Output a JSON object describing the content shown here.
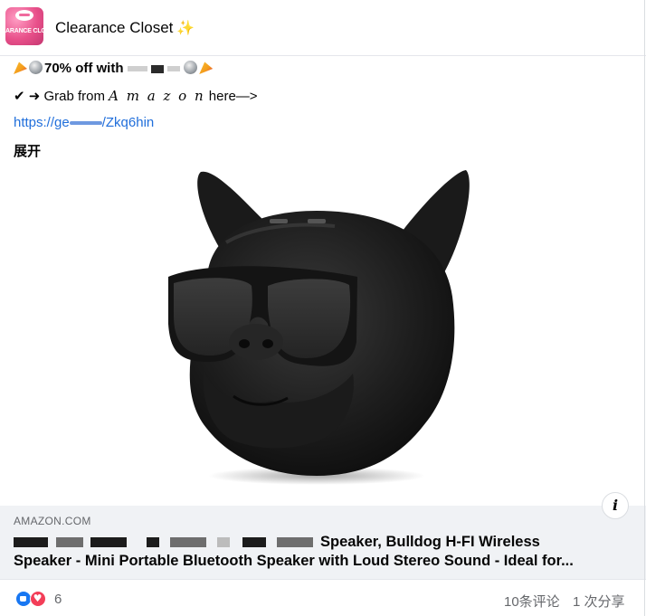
{
  "header": {
    "page_name": "Clearance Closet",
    "sparkle": "✨",
    "avatar_text": "ARANCE CLO"
  },
  "post": {
    "line1_text": "70% off with",
    "line2_prefix": "✔ ➜ Grab from",
    "line2_store": "𝐴 𝑚 𝑎 𝑧 𝑜 𝑛",
    "line2_suffix": "here—>",
    "link_start": "https://ge",
    "link_end": "/Zkq6hin",
    "expand": "展开"
  },
  "link_preview": {
    "domain": "AMAZON.COM",
    "title_line1_visible": "Speaker, Bulldog H-FI Wireless",
    "title_line2": "Speaker - Mini Portable Bluetooth Speaker with Loud Stereo Sound - Ideal for...",
    "info_icon": "i"
  },
  "footer": {
    "reaction_count": "6",
    "comments": "10条评论",
    "shares": "1 次分享"
  },
  "colors": {
    "link": "#216fdb",
    "like": "#1877f2",
    "love": "#f33e58",
    "preview_bg": "#f0f2f5"
  }
}
